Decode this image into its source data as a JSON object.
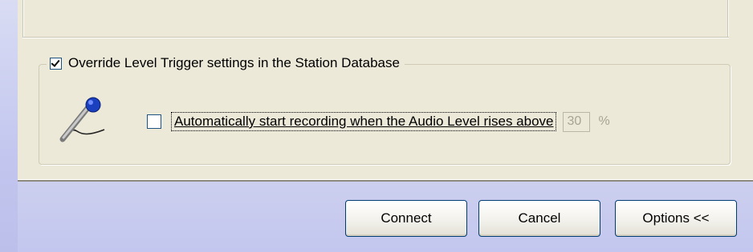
{
  "dialog": {
    "level_trigger_group": {
      "override_checkbox": {
        "label": "Override Level Trigger settings in the Station Database",
        "checked": true
      },
      "auto_record": {
        "label": "Automatically start recording when the Audio Level rises above",
        "checked": false,
        "level_value": "30",
        "unit": "%"
      },
      "icon": "microphone-icon"
    },
    "buttons": {
      "connect": "Connect",
      "cancel": "Cancel",
      "options": "Options <<"
    }
  },
  "colors": {
    "dialog_background": "#ece9d8",
    "footer_background": "#c3c7ef",
    "button_border": "#003c74",
    "mic_head": "#1a3fbf"
  }
}
